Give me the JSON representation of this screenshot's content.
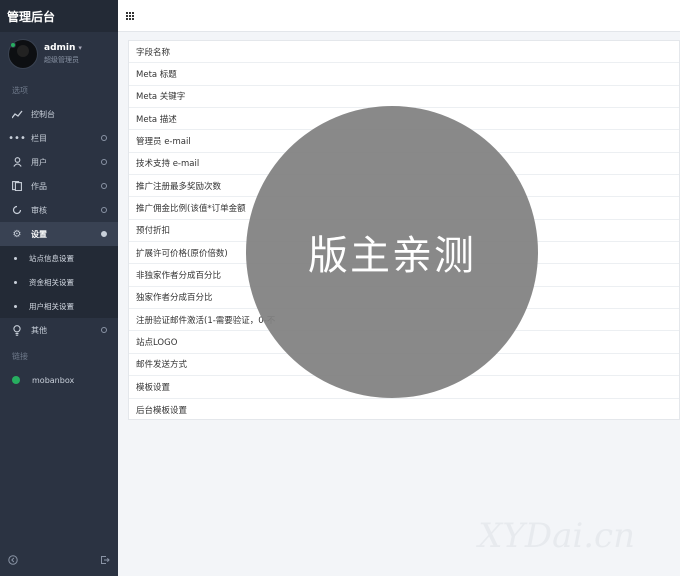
{
  "sidebar": {
    "brand": "管理后台",
    "user": {
      "name": "admin",
      "role": "超级管理员"
    },
    "section_options": "选项",
    "items": [
      {
        "label": "控制台",
        "icon": "chart-line-icon"
      },
      {
        "label": "栏目",
        "icon": "dots-icon"
      },
      {
        "label": "用户",
        "icon": "user-icon"
      },
      {
        "label": "作品",
        "icon": "copy-icon"
      },
      {
        "label": "审核",
        "icon": "refresh-icon"
      },
      {
        "label": "设置",
        "icon": "gear-icon"
      },
      {
        "label": "其他",
        "icon": "bulb-icon"
      }
    ],
    "settings_sub": [
      "站点信息设置",
      "资金相关设置",
      "用户相关设置"
    ],
    "section_links": "链接",
    "links": [
      {
        "label": "mobanbox"
      }
    ],
    "footer": {
      "left_icon": "collapse-icon",
      "right_icon": "logout-icon"
    }
  },
  "table": {
    "rows": [
      "字段名称",
      "Meta 标题",
      "Meta 关键字",
      "Meta 描述",
      "管理员 e-mail",
      "技术支持 e-mail",
      "推广注册最多奖励次数",
      "推广佣金比例(该值*订单金额",
      "预付折扣",
      "扩展许可价格(原价倍数)",
      "非独家作者分成百分比",
      "独家作者分成百分比",
      "注册验证邮件激活(1-需要验证，0-不",
      "站点LOGO",
      "邮件发送方式",
      "模板设置",
      "后台模板设置"
    ]
  },
  "overlay": {
    "stamp_text": "版主亲测",
    "corner_mark": "XYDai.cn"
  }
}
